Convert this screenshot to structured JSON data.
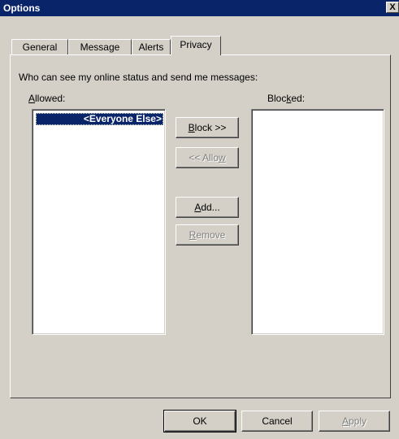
{
  "window": {
    "title": "Options",
    "close_glyph": "X"
  },
  "tabs": [
    {
      "label": "General",
      "active": false
    },
    {
      "label": "Message",
      "active": false
    },
    {
      "label": "Alerts",
      "active": false
    },
    {
      "label": "Privacy",
      "active": true
    }
  ],
  "privacy": {
    "description": "Who can see my online status and send me messages:",
    "allowed_label": "Allowed:",
    "blocked_label": "Blocked:",
    "allowed_items": [
      "<Everyone Else>"
    ],
    "blocked_items": []
  },
  "buttons": {
    "block": "Block >>",
    "allow": "<< Allow",
    "add": "Add...",
    "remove": "Remove",
    "ok": "OK",
    "cancel": "Cancel",
    "apply": "Apply"
  }
}
